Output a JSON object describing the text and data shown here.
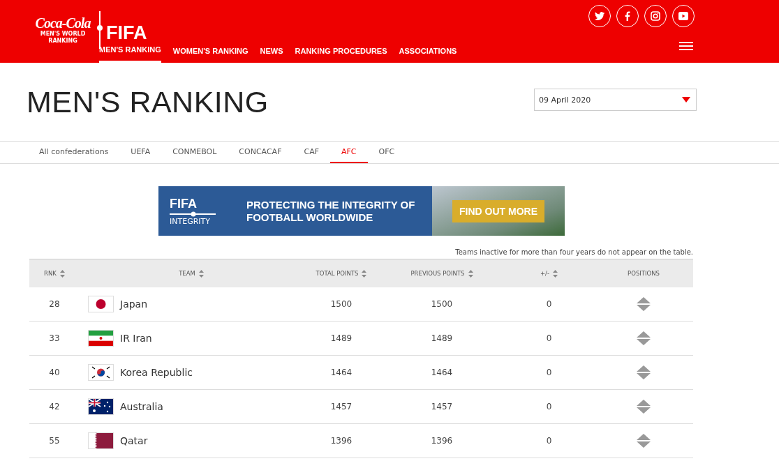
{
  "header": {
    "logo_brand": "Coca-Cola",
    "logo_caption": "MEN'S WORLD RANKING",
    "logo_org": "FIFA",
    "nav": [
      {
        "label": "MEN'S RANKING",
        "selected": true
      },
      {
        "label": "WOMEN'S RANKING",
        "selected": false
      },
      {
        "label": "NEWS",
        "selected": false
      },
      {
        "label": "RANKING PROCEDURES",
        "selected": false
      },
      {
        "label": "ASSOCIATIONS",
        "selected": false
      }
    ],
    "social": [
      {
        "kind": "twitter"
      },
      {
        "kind": "facebook"
      },
      {
        "kind": "instagram"
      },
      {
        "kind": "youtube"
      }
    ]
  },
  "page_title": "MEN'S RANKING",
  "date_select": {
    "value": "09 April 2020"
  },
  "tabs": [
    {
      "label": "All confederations",
      "selected": false
    },
    {
      "label": "UEFA",
      "selected": false
    },
    {
      "label": "CONMEBOL",
      "selected": false
    },
    {
      "label": "CONCACAF",
      "selected": false
    },
    {
      "label": "CAF",
      "selected": false
    },
    {
      "label": "AFC",
      "selected": true
    },
    {
      "label": "OFC",
      "selected": false
    }
  ],
  "banner": {
    "org": "FIFA",
    "sub": "INTEGRITY",
    "headline": "PROTECTING THE INTEGRITY OF FOOTBALL WORLDWIDE",
    "cta": "FIND OUT MORE"
  },
  "note": "Teams inactive for more than four years do not appear on the table.",
  "table": {
    "columns": [
      {
        "label": "RNK",
        "sortable": true
      },
      {
        "label": "TEAM",
        "sortable": true
      },
      {
        "label": "TOTAL POINTS",
        "sortable": true
      },
      {
        "label": "PREVIOUS POINTS",
        "sortable": true
      },
      {
        "label": "+/-",
        "sortable": true
      },
      {
        "label": "POSITIONS",
        "sortable": false
      }
    ],
    "rows": [
      {
        "rank": "28",
        "kind": "japan",
        "team": "Japan",
        "total": "1500",
        "previous": "1500",
        "change": "0"
      },
      {
        "rank": "33",
        "kind": "iran",
        "team": "IR Iran",
        "total": "1489",
        "previous": "1489",
        "change": "0"
      },
      {
        "rank": "40",
        "kind": "korea",
        "team": "Korea Republic",
        "total": "1464",
        "previous": "1464",
        "change": "0"
      },
      {
        "rank": "42",
        "kind": "australia",
        "team": "Australia",
        "total": "1457",
        "previous": "1457",
        "change": "0"
      },
      {
        "rank": "55",
        "kind": "qatar",
        "team": "Qatar",
        "total": "1396",
        "previous": "1396",
        "change": "0"
      }
    ]
  }
}
